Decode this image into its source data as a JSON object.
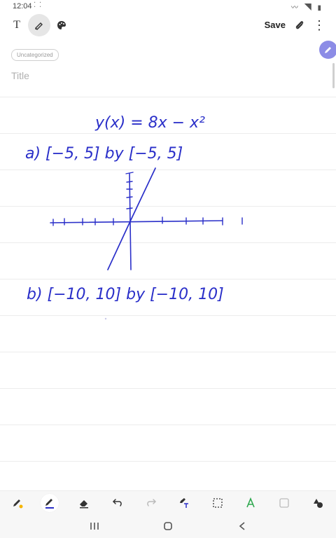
{
  "status_bar": {
    "time": "12:04",
    "indicator_dots": "⁚ ⁚",
    "icons": [
      "vibrate-icon",
      "wifi-icon",
      "battery-icon"
    ]
  },
  "toolbar": {
    "text_mode_label": "T",
    "save_label": "Save",
    "more_label": "⋮"
  },
  "note": {
    "category_tag": "Uncategorized",
    "title_placeholder": "Title"
  },
  "handwriting": {
    "function_line": "y(x) = 8x − x²",
    "part_a": "a) [−5, 5]  by  [−5, 5]",
    "part_b": "b) [−10, 10]  by  [−10, 10]"
  },
  "bottom_toolbar": {
    "tools": [
      "pen-settings-icon",
      "pen-icon",
      "eraser-icon",
      "undo-icon",
      "redo-icon",
      "text-recognize-icon",
      "selection-icon",
      "style-icon",
      "shape-icon",
      "insert-shape-icon"
    ]
  },
  "colors": {
    "ink": "#2a2fc9",
    "accent": "#8c8ce6"
  }
}
